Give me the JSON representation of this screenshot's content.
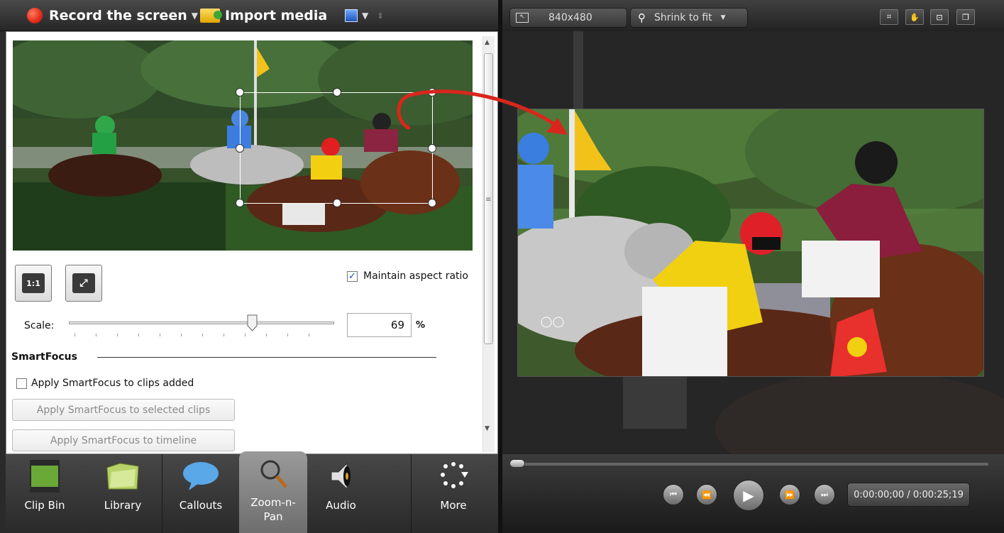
{
  "toolbar": {
    "record_label": "Record the screen",
    "import_label": "Import media"
  },
  "zoom_panel": {
    "maintain_aspect_label": "Maintain aspect ratio",
    "maintain_aspect_checked": true,
    "scale_label": "Scale:",
    "scale_value": "69",
    "scale_unit": "%",
    "scale_fraction": 0.69,
    "ratio_button_label": "1:1",
    "smartfocus_heading": "SmartFocus",
    "apply_clips_label": "Apply SmartFocus to clips added",
    "apply_selected_label": "Apply SmartFocus to selected clips",
    "apply_timeline_label": "Apply SmartFocus to timeline"
  },
  "tabs": [
    {
      "label": "Clip Bin",
      "icon": "film-strip-icon",
      "active": false
    },
    {
      "label": "Library",
      "icon": "folder-icon",
      "active": false
    },
    {
      "label": "Callouts",
      "icon": "speech-bubble-icon",
      "active": false
    },
    {
      "label": "Zoom-n-\nPan",
      "icon": "magnifier-icon",
      "active": true
    },
    {
      "label": "Audio",
      "icon": "speaker-icon",
      "active": false
    },
    {
      "label": "More",
      "icon": "more-dots-icon",
      "active": false
    }
  ],
  "preview": {
    "dimensions_label": "840x480",
    "zoom_label": "Shrink to fit"
  },
  "playback": {
    "timecode": "0:00:00;00 / 0:00:25;19",
    "position_fraction": 0.0
  },
  "colors": {
    "record_red": "#e8301c",
    "annotation_arrow": "#d9261c",
    "accent_blue": "#1b4fb3"
  }
}
